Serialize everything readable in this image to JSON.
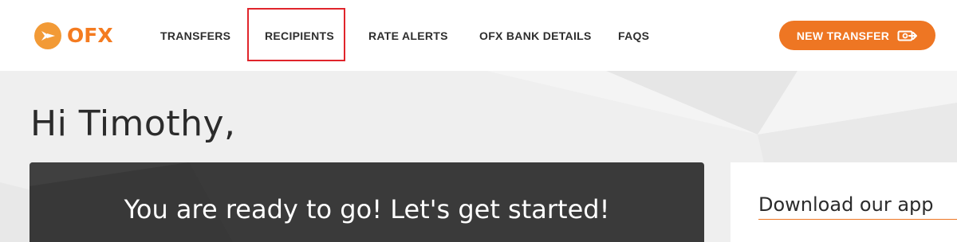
{
  "brand": {
    "name": "OFX",
    "accent": "#ee7623",
    "highlight": "#e0252b",
    "card_dark": "#3a3a3a"
  },
  "nav": {
    "items": [
      {
        "label": "TRANSFERS"
      },
      {
        "label": "RECIPIENTS"
      },
      {
        "label": "RATE ALERTS"
      },
      {
        "label": "OFX BANK DETAILS"
      },
      {
        "label": "FAQS"
      }
    ],
    "cta_label": "NEW TRANSFER",
    "cta_icon": "money-transfer-icon"
  },
  "greeting": "Hi Timothy,",
  "main_card": {
    "title": "You are ready to go! Let's get started!"
  },
  "side_card": {
    "title": "Download our app"
  }
}
